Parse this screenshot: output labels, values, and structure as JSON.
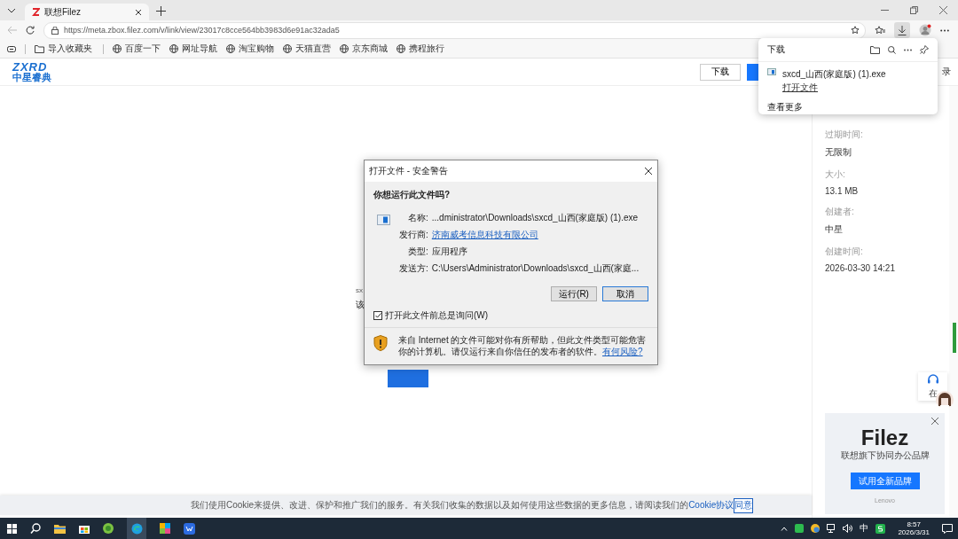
{
  "browser": {
    "tabs": [
      {
        "title": "联想Filez",
        "selected": true
      }
    ],
    "url": "https://meta.zbox.filez.com/v/link/view/23017c8cce564bb3983d6e91ac32ada5",
    "bookmarks": [
      "导入收藏夹",
      "百度一下",
      "网址导航",
      "淘宝购物",
      "天猫直营",
      "京东商城",
      "携程旅行"
    ]
  },
  "header": {
    "logo_top": "ZXRD",
    "logo_bottom": "中星睿典",
    "download_button": "下载",
    "login_fragment": "录"
  },
  "content_fragments": [
    "sx",
    "该"
  ],
  "file_info": [
    {
      "label": "过期时间:",
      "value": "无限制"
    },
    {
      "label": "大小:",
      "value": "13.1 MB"
    },
    {
      "label": "创建者:",
      "value": "中星"
    },
    {
      "label": "创建时间:",
      "value": "2026-03-30 14:21"
    }
  ],
  "downloads_panel": {
    "title": "下载",
    "items": [
      {
        "name": "sxcd_山西(家庭版) (1).exe",
        "action": "打开文件"
      }
    ],
    "more": "查看更多"
  },
  "dialog": {
    "title": "打开文件 - 安全警告",
    "question": "你想运行此文件吗?",
    "fields": [
      {
        "label": "名称:",
        "value": "...dministrator\\Downloads\\sxcd_山西(家庭版) (1).exe",
        "link": false
      },
      {
        "label": "发行商:",
        "value": "济南威考信息科技有限公司",
        "link": true
      },
      {
        "label": "类型:",
        "value": "应用程序",
        "link": false
      },
      {
        "label": "发送方:",
        "value": "C:\\Users\\Administrator\\Downloads\\sxcd_山西(家庭...",
        "link": false
      }
    ],
    "buttons": [
      {
        "label": "运行(R)",
        "selected": false
      },
      {
        "label": "取消",
        "selected": true
      }
    ],
    "ask_checkbox": {
      "label": "打开此文件前总是询问(W)",
      "checked": true
    },
    "warning": "来自 Internet 的文件可能对你有所帮助，但此文件类型可能危害你的计算机。请仅运行来自你信任的发布者的软件。",
    "warning_link": "有何风险?"
  },
  "support": {
    "label": "在"
  },
  "ad": {
    "brand": "Filez",
    "tagline": "联想旗下协同办公品牌",
    "button": "试用全新品牌",
    "footer": "Lenovo"
  },
  "cookie_bar": {
    "text": "我们使用Cookie来提供、改进、保护和推广我们的服务。有关我们收集的数据以及如何使用这些数据的更多信息，请阅读我们的",
    "link": "Cookie协议",
    "button": "同意"
  },
  "taskbar": {
    "ime": "中",
    "time": "8:57",
    "date": "2026/3/31"
  }
}
